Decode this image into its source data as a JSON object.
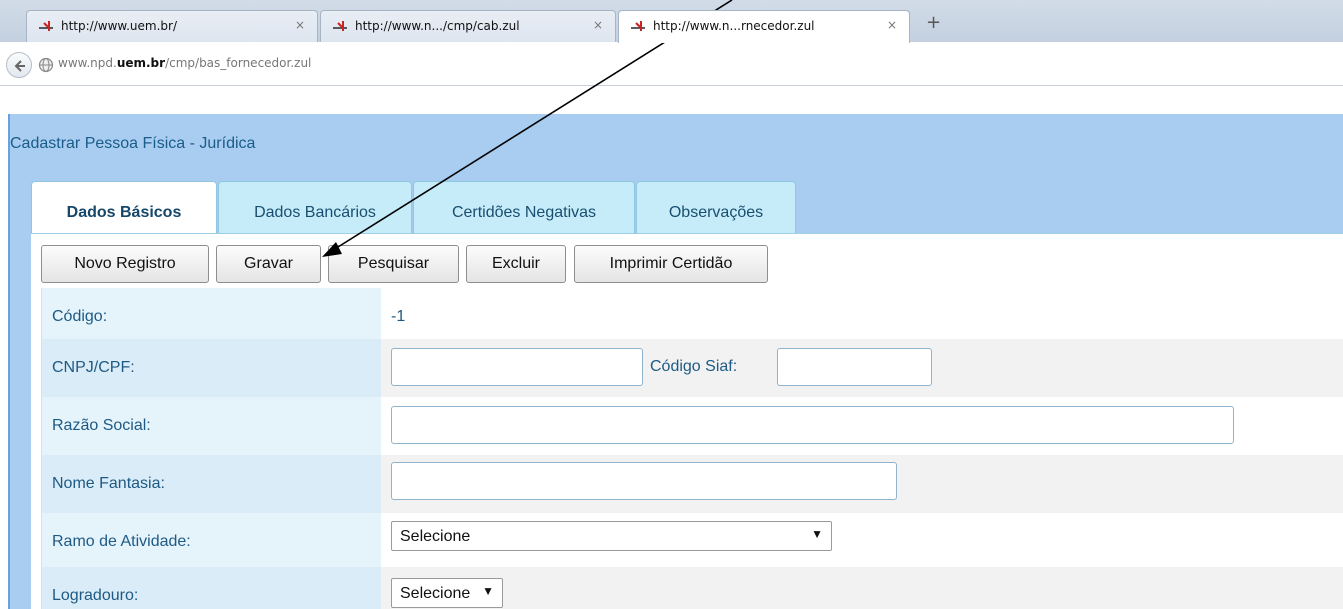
{
  "browser": {
    "tabs": [
      {
        "title": "http://www.uem.br/",
        "close": "×"
      },
      {
        "title": "http://www.n.../cmp/cab.zul",
        "close": "×"
      },
      {
        "title": "http://www.n...rnecedor.zul",
        "close": "×"
      }
    ],
    "new_tab": "+",
    "address": {
      "prefix": "www.npd.",
      "domain": "uem.br",
      "path": "/cmp/bas_fornecedor.zul"
    }
  },
  "app": {
    "title": "Cadastrar Pessoa Física - Jurídica",
    "tabs": [
      "Dados Básicos",
      "Dados Bancários",
      "Certidões Negativas",
      "Observações"
    ],
    "toolbar": {
      "novo": "Novo Registro",
      "gravar": "Gravar",
      "pesquisar": "Pesquisar",
      "excluir": "Excluir",
      "imprimir": "Imprimir Certidão"
    },
    "form": {
      "codigo_label": "Código:",
      "codigo_value": "-1",
      "cnpj_label": "CNPJ/CPF:",
      "siaf_label": "Código Siaf:",
      "razao_label": "Razão Social:",
      "fantasia_label": "Nome Fantasia:",
      "ramo_label": "Ramo de Atividade:",
      "ramo_value": "Selecione",
      "logradouro_label": "Logradouro:",
      "logradouro_value": "Selecione"
    }
  }
}
